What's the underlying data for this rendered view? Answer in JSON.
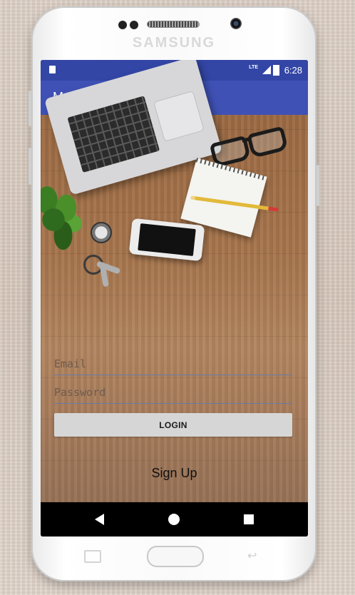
{
  "device": {
    "brand": "SAMSUNG"
  },
  "status_bar": {
    "network": "LTE",
    "time": "6:28",
    "icons": [
      "sd-card-icon",
      "signal-icon",
      "battery-charging-icon"
    ]
  },
  "app_bar": {
    "title": "Masterly"
  },
  "login_form": {
    "email_placeholder": "Email",
    "password_placeholder": "Password",
    "login_label": "LOGIN",
    "signup_label": "Sign Up"
  },
  "nav_bar": {
    "icons": [
      "back-icon",
      "home-icon",
      "recents-icon"
    ]
  }
}
